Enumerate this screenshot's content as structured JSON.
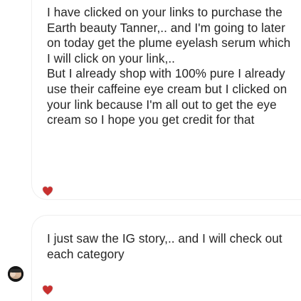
{
  "messages": [
    {
      "paragraphs": [
        "I have clicked on your links to purchase the Earth beauty Tanner,.. and I'm going to later on today get the plume eyelash serum which I will click on your link,..",
        "But I already shop with 100% pure I already use their caffeine eye cream but I clicked on your link because I'm all out to get the eye cream so I hope you get credit for that"
      ],
      "reaction": "heart-icon"
    },
    {
      "paragraphs": [
        "I just saw the IG story,.. and I will check out each category"
      ],
      "reaction": "heart-icon"
    }
  ],
  "colors": {
    "text": "#262626",
    "heart": "#c8302f",
    "border": "#efefef"
  }
}
